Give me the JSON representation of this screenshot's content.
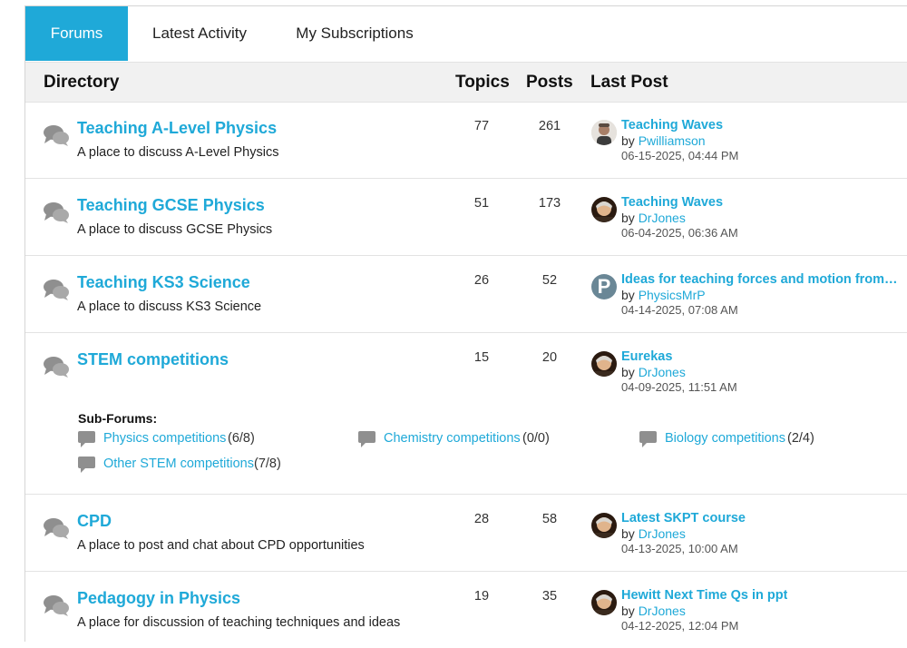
{
  "tabs": [
    {
      "label": "Forums"
    },
    {
      "label": "Latest Activity"
    },
    {
      "label": "My Subscriptions"
    }
  ],
  "header": {
    "directory": "Directory",
    "topics": "Topics",
    "posts": "Posts",
    "last_post": "Last Post"
  },
  "icons": {
    "forum": "forum-bubbles-icon",
    "subforum": "speech-bubble-icon"
  },
  "colors": {
    "accent": "#1fa9d8",
    "header_bg": "#f1f1f1"
  },
  "forums": [
    {
      "title": "Teaching A-Level Physics",
      "description": "A place to discuss A-Level Physics",
      "topics": "77",
      "posts": "261",
      "last_post": {
        "title": "Teaching Waves",
        "by": "by ",
        "author": "Pwilliamson",
        "date": "06-15-2025, 04:44 PM"
      }
    },
    {
      "title": "Teaching GCSE Physics",
      "description": "A place to discuss GCSE Physics",
      "topics": "51",
      "posts": "173",
      "last_post": {
        "title": "Teaching Waves",
        "by": "by ",
        "author": "DrJones",
        "date": "06-04-2025, 06:36 AM"
      }
    },
    {
      "title": "Teaching KS3 Science",
      "description": "A place to discuss KS3 Science",
      "topics": "26",
      "posts": "52",
      "last_post": {
        "title": "Ideas for teaching forces and motion from ...",
        "by": "by ",
        "author": "PhysicsMrP",
        "date": "04-14-2025, 07:08 AM",
        "avatar_letter": "P"
      }
    },
    {
      "title": "STEM competitions",
      "description": "",
      "topics": "15",
      "posts": "20",
      "last_post": {
        "title": "Eurekas",
        "by": "by ",
        "author": "DrJones",
        "date": "04-09-2025, 11:51 AM"
      },
      "subforums_label": "Sub-Forums:",
      "subforums": [
        {
          "name": "Physics competitions",
          "count": "(6/8)"
        },
        {
          "name": "Chemistry competitions",
          "count": "(0/0)"
        },
        {
          "name": "Biology competitions",
          "count": "(2/4)"
        },
        {
          "name": "Other STEM competitions",
          "count": "(7/8)"
        }
      ]
    },
    {
      "title": "CPD",
      "description": "A place to post and chat about CPD opportunities",
      "topics": "28",
      "posts": "58",
      "last_post": {
        "title": "Latest SKPT course",
        "by": "by ",
        "author": "DrJones",
        "date": "04-13-2025, 10:00 AM"
      }
    },
    {
      "title": "Pedagogy in Physics",
      "description": "A place for discussion of teaching techniques and ideas",
      "topics": "19",
      "posts": "35",
      "last_post": {
        "title": "Hewitt Next Time Qs in ppt",
        "by": "by ",
        "author": "DrJones",
        "date": "04-12-2025, 12:04 PM"
      }
    }
  ]
}
